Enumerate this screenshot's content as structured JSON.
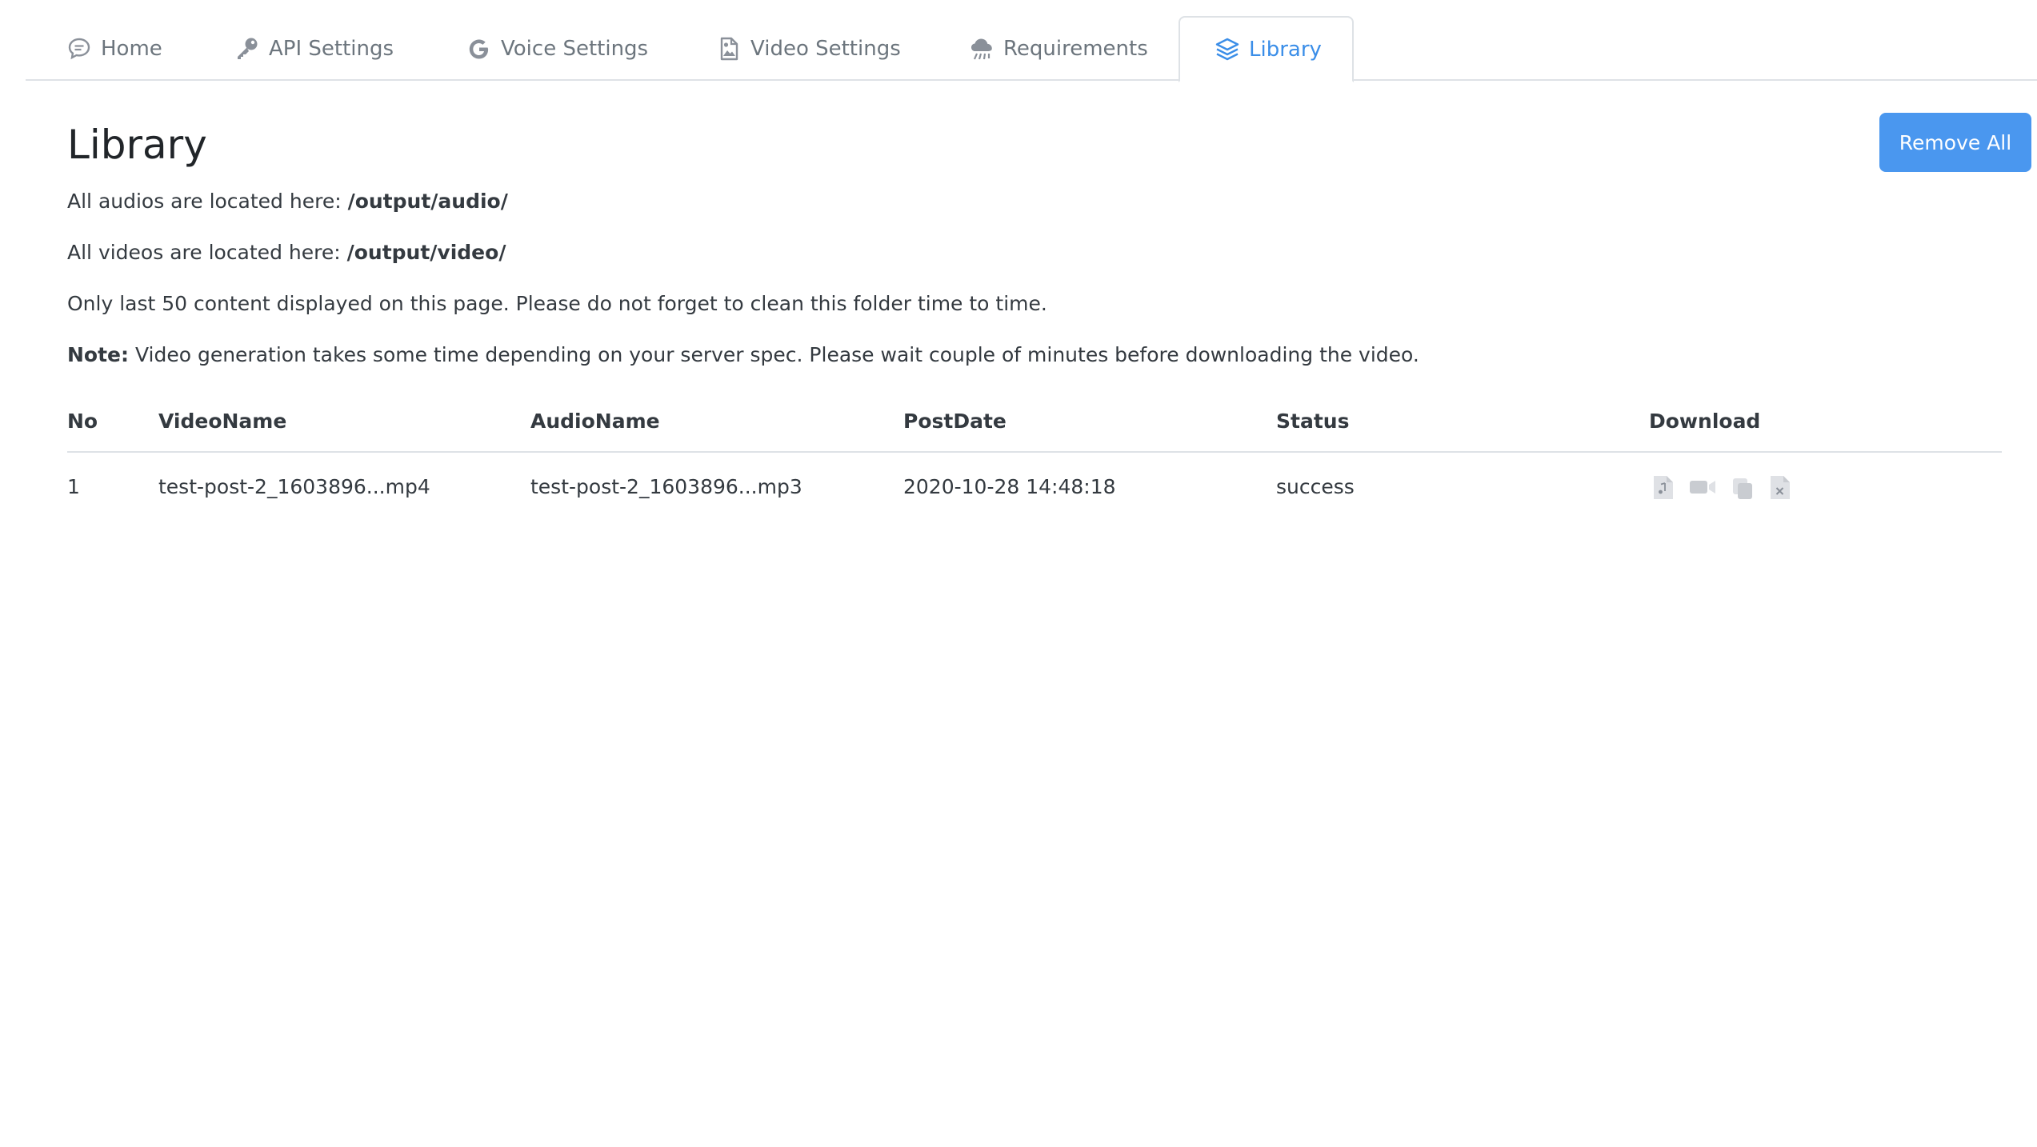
{
  "tabs": [
    {
      "label": "Home",
      "icon": "chat-bubble-icon",
      "active": false
    },
    {
      "label": "API Settings",
      "icon": "key-icon",
      "active": false
    },
    {
      "label": "Voice Settings",
      "icon": "google-g-icon",
      "active": false
    },
    {
      "label": "Video Settings",
      "icon": "image-file-icon",
      "active": false
    },
    {
      "label": "Requirements",
      "icon": "cloud-icon",
      "active": false
    },
    {
      "label": "Library",
      "icon": "layers-icon",
      "active": true
    }
  ],
  "page": {
    "title": "Library",
    "remove_all_label": "Remove All",
    "audio_location_prefix": "All audios are located here: ",
    "audio_location_path": "/output/audio/",
    "video_location_prefix": "All videos are located here: ",
    "video_location_path": "/output/video/",
    "content_notice": "Only last 50 content displayed on this page. Please do not forget to clean this folder time to time.",
    "note_label": "Note:",
    "note_text": " Video generation takes some time depending on your server spec. Please wait couple of minutes before downloading the video."
  },
  "table": {
    "headers": [
      "No",
      "VideoName",
      "AudioName",
      "PostDate",
      "Status",
      "Download"
    ],
    "rows": [
      {
        "no": "1",
        "video_name": "test-post-2_1603896...mp4",
        "audio_name": "test-post-2_1603896...mp3",
        "post_date": "2020-10-28 14:48:18",
        "status": "success",
        "download_icons": [
          "audio-file-icon",
          "video-camera-icon",
          "copy-icon",
          "delete-file-icon"
        ]
      }
    ]
  },
  "colors": {
    "accent": "#3b8ee8",
    "button_bg": "#4a97ef",
    "tab_inactive": "#6c757d",
    "border": "#dee2e6",
    "icon_muted": "#c9ccd1"
  }
}
